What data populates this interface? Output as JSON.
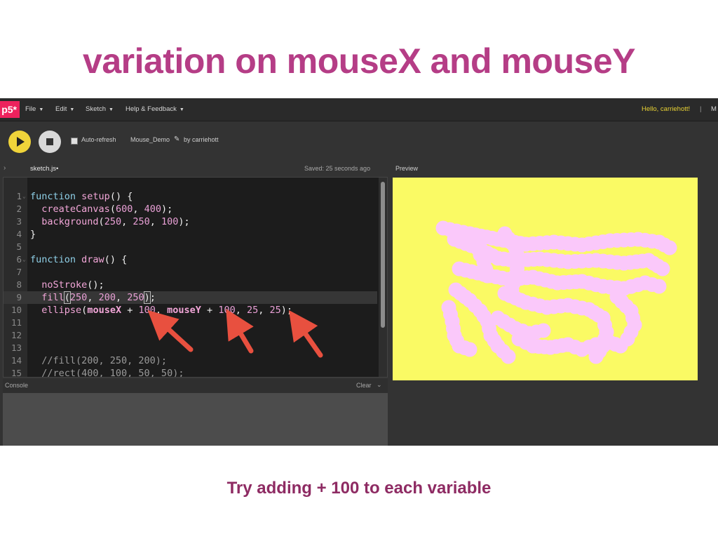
{
  "slide": {
    "title": "variation on mouseX and mouseY",
    "caption": "Try adding + 100 to each variable"
  },
  "menubar": {
    "logo": "p5*",
    "items": [
      {
        "label": "File",
        "caret": "▼"
      },
      {
        "label": "Edit",
        "caret": "▼"
      },
      {
        "label": "Sketch",
        "caret": "▼"
      },
      {
        "label": "Help & Feedback",
        "caret": "▼"
      }
    ],
    "greeting": "Hello, carriehott!",
    "separator": "|",
    "more": "M"
  },
  "toolbar": {
    "auto_refresh_label": "Auto-refresh",
    "sketch_name": "Mouse_Demo",
    "pencil": "✎",
    "by_user": "by carriehott"
  },
  "tabs": {
    "file": "sketch.js•",
    "saved": "Saved: 25 seconds ago",
    "preview": "Preview",
    "toggle": "›"
  },
  "editor": {
    "lines": [
      "1",
      "2",
      "3",
      "4",
      "5",
      "6",
      "7",
      "8",
      "9",
      "10",
      "11",
      "12",
      "13",
      "14",
      "15"
    ]
  },
  "console": {
    "label": "Console",
    "clear": "Clear",
    "chevron": "⌄"
  },
  "colors": {
    "accent": "#ed225d",
    "canvas_bg": "#fafa64",
    "ellipse_fill": "#fac8fa",
    "arrow": "#e8503f"
  }
}
